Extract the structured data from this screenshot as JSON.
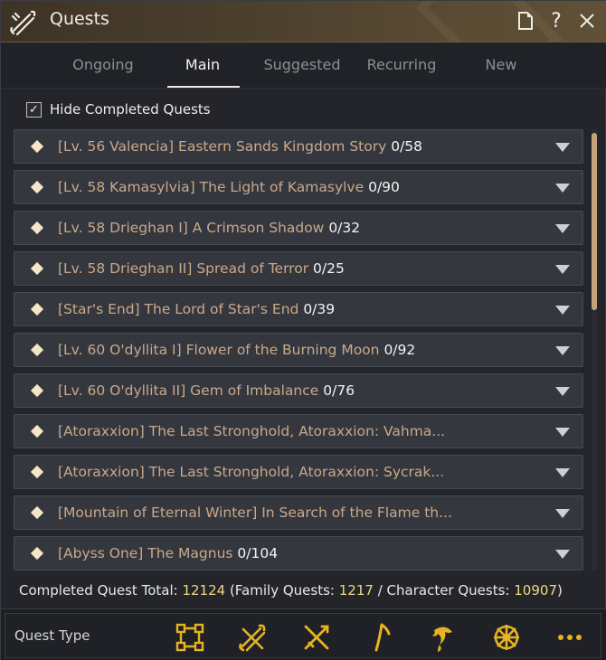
{
  "window": {
    "title": "Quests"
  },
  "tabs": [
    {
      "label": "Ongoing"
    },
    {
      "label": "Main"
    },
    {
      "label": "Suggested"
    },
    {
      "label": "Recurring"
    },
    {
      "label": "New"
    }
  ],
  "active_tab": "Main",
  "hide_completed": {
    "label": "Hide Completed Quests",
    "checked": true
  },
  "quests": [
    {
      "title": "[Lv. 56 Valencia] Eastern Sands Kingdom Story",
      "count": "0/58"
    },
    {
      "title": "[Lv. 58 Kamasylvia] The Light of Kamasylve",
      "count": "0/90"
    },
    {
      "title": "[Lv. 58 Drieghan I] A Crimson Shadow",
      "count": "0/32"
    },
    {
      "title": "[Lv. 58 Drieghan II] Spread of Terror",
      "count": "0/25"
    },
    {
      "title": "[Star's End] The Lord of Star's End",
      "count": "0/39"
    },
    {
      "title": "[Lv. 60 O'dyllita I] Flower of the Burning Moon",
      "count": "0/92"
    },
    {
      "title": "[Lv. 60 O'dyllita II] Gem of Imbalance",
      "count": "0/76"
    },
    {
      "title": "[Atoraxxion] The Last Stronghold, Atoraxxion: Vahma...",
      "count": ""
    },
    {
      "title": "[Atoraxxion] The Last Stronghold, Atoraxxion: Sycrak...",
      "count": ""
    },
    {
      "title": "[Mountain of Eternal Winter] In Search of the Flame th...",
      "count": ""
    },
    {
      "title": "[Abyss One] The Magnus",
      "count": "0/104"
    }
  ],
  "totals": {
    "label": "Completed Quest Total:",
    "total": "12124",
    "family_label": "(Family Quests:",
    "family": "1217",
    "sep": "/",
    "character_label": "Character Quests:",
    "character": "10907",
    "close": ")"
  },
  "quest_type": {
    "label": "Quest Type",
    "icons": [
      "combat-quest-icon",
      "trade-quest-icon",
      "combat-swords-icon",
      "gathering-pick-icon",
      "fishing-icon",
      "sailing-wheel-icon",
      "more-icon"
    ]
  },
  "colors": {
    "accent": "#e6b422",
    "quest_text": "#c9a98a",
    "highlight": "#f2d77d"
  }
}
